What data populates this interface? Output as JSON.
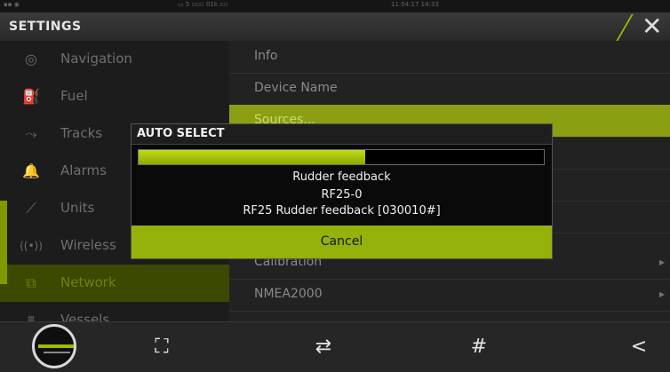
{
  "window": {
    "title": "SETTINGS",
    "close_label": "✕"
  },
  "statusbar": {
    "left_text": "▪▪ ◉",
    "mid_text": "▭ 5 ▫▫▫ 01k ▫▫",
    "clock_text": "11:54:17   14:33"
  },
  "sidebar": {
    "items": [
      {
        "label": "Navigation",
        "icon": "compass-icon",
        "glyph": "◎"
      },
      {
        "label": "Fuel",
        "icon": "fuel-pump-icon",
        "glyph": "⛽"
      },
      {
        "label": "Tracks",
        "icon": "tracks-icon",
        "glyph": "⤳"
      },
      {
        "label": "Alarms",
        "icon": "bell-icon",
        "glyph": "🔔"
      },
      {
        "label": "Units",
        "icon": "ruler-icon",
        "glyph": "⟋"
      },
      {
        "label": "Wireless",
        "icon": "wireless-icon",
        "glyph": "((•))"
      },
      {
        "label": "Network",
        "icon": "network-icon",
        "glyph": "⧉"
      },
      {
        "label": "Vessels",
        "icon": "vessels-icon",
        "glyph": "⩩"
      }
    ],
    "active": "Network"
  },
  "network_menu": {
    "items": [
      {
        "label": "Info",
        "selected": false,
        "has_arrow": false
      },
      {
        "label": "Device Name",
        "selected": false,
        "has_arrow": false
      },
      {
        "label": "Sources...",
        "selected": true,
        "has_arrow": false
      },
      {
        "label": "",
        "selected": false,
        "has_arrow": false
      },
      {
        "label": "",
        "selected": false,
        "has_arrow": false
      },
      {
        "label": "",
        "selected": false,
        "has_arrow": false
      },
      {
        "label": "Calibration",
        "selected": false,
        "has_arrow": true
      },
      {
        "label": "NMEA2000",
        "selected": false,
        "has_arrow": true
      }
    ]
  },
  "dialog": {
    "title": "AUTO SELECT",
    "progress_percent": 56,
    "line1": "Rudder feedback",
    "line2": "RF25-0",
    "line3": "RF25 Rudder feedback [030010#]",
    "cancel_label": "Cancel"
  },
  "toolbar": {
    "buttons": [
      {
        "name": "focus-icon",
        "glyph": "⛶"
      },
      {
        "name": "edit-route-icon",
        "glyph": "⇄"
      },
      {
        "name": "grid-icon",
        "glyph": "#"
      },
      {
        "name": "share-icon",
        "glyph": "<"
      }
    ]
  },
  "colors": {
    "accent": "#95b20a",
    "accent_dark": "#3b4a00"
  }
}
